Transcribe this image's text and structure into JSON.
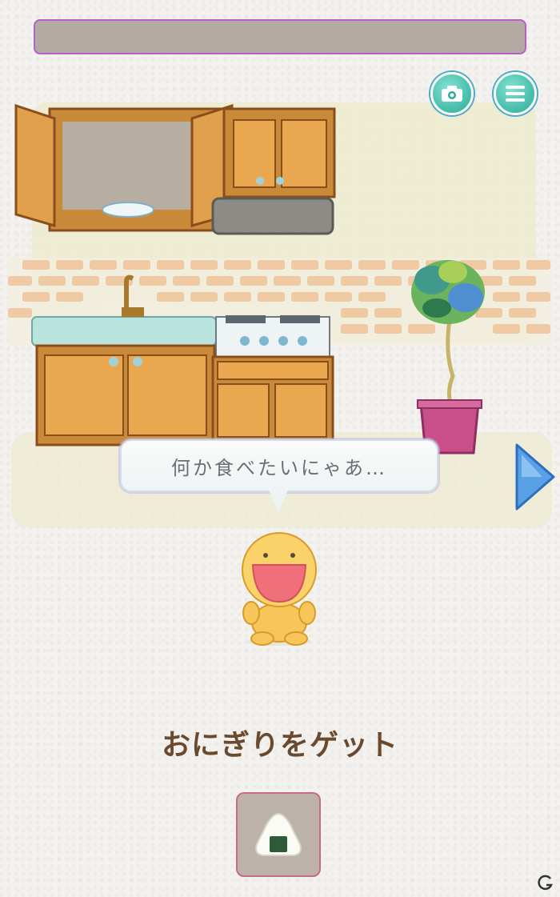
{
  "header": {
    "bar_color": "#b3aaa3",
    "bar_border_color": "#b85ec8"
  },
  "toolbar": {
    "camera_icon": "camera-icon",
    "menu_icon": "menu-icon",
    "button_color": "#2ca996"
  },
  "scene": {
    "room": "kitchen",
    "objects": [
      "wall-cabinet-open",
      "plate",
      "range-hood",
      "sink",
      "faucet",
      "stove",
      "lower-cabinets",
      "potted-plant"
    ]
  },
  "speech": {
    "text": "何か食べたいにゃあ…"
  },
  "navigation": {
    "next_icon": "next-arrow-icon"
  },
  "character": {
    "expression": "happy-open-mouth"
  },
  "reward": {
    "message": "おにぎりをゲット",
    "item_icon": "onigiri-icon"
  }
}
